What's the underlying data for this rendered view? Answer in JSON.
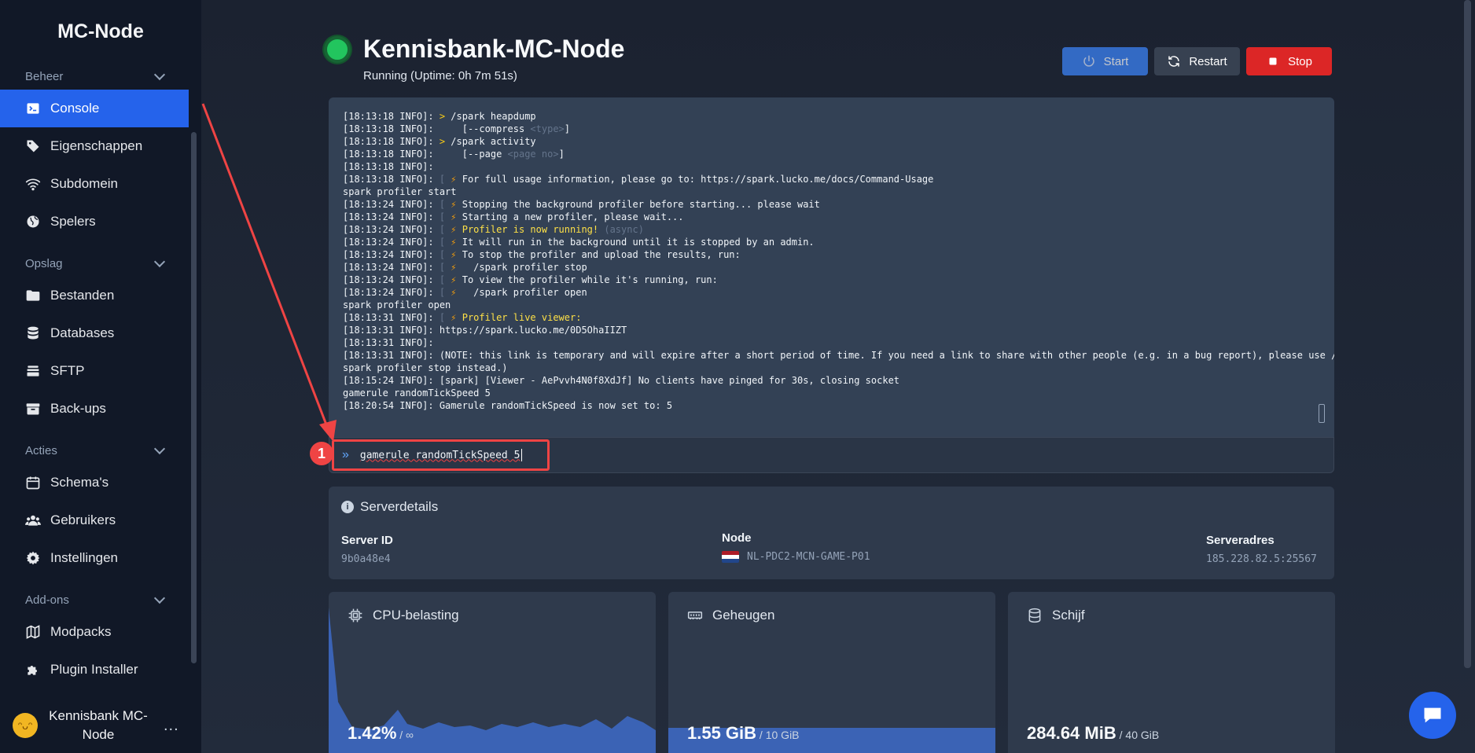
{
  "app": {
    "brand": "MC-Node"
  },
  "sidebar": {
    "sections": [
      {
        "label": "Beheer",
        "items": [
          {
            "label": "Console",
            "icon": "terminal-icon",
            "active": true
          },
          {
            "label": "Eigenschappen",
            "icon": "tag-icon"
          },
          {
            "label": "Subdomein",
            "icon": "wifi-icon"
          },
          {
            "label": "Spelers",
            "icon": "globe-icon"
          }
        ]
      },
      {
        "label": "Opslag",
        "items": [
          {
            "label": "Bestanden",
            "icon": "folder-icon"
          },
          {
            "label": "Databases",
            "icon": "database-icon"
          },
          {
            "label": "SFTP",
            "icon": "layers-icon"
          },
          {
            "label": "Back-ups",
            "icon": "archive-icon"
          }
        ]
      },
      {
        "label": "Acties",
        "items": [
          {
            "label": "Schema's",
            "icon": "calendar-icon"
          },
          {
            "label": "Gebruikers",
            "icon": "users-icon"
          },
          {
            "label": "Instellingen",
            "icon": "gear-icon"
          }
        ]
      },
      {
        "label": "Add-ons",
        "items": [
          {
            "label": "Modpacks",
            "icon": "map-icon"
          },
          {
            "label": "Plugin Installer",
            "icon": "puzzle-icon"
          }
        ]
      }
    ],
    "user": {
      "name": "Kennisbank MC-Node",
      "more": "..."
    }
  },
  "header": {
    "title": "Kennisbank-MC-Node",
    "status": "Running (Uptime: 0h 7m 51s)",
    "status_color": "#22c55e",
    "buttons": {
      "start": "Start",
      "restart": "Restart",
      "stop": "Stop"
    }
  },
  "console": {
    "lines": [
      {
        "p": "[18:13:18 INFO]: ",
        "c": "> ",
        "t": "/spark heapdump"
      },
      {
        "p": "[18:13:18 INFO]: ",
        "t": "    [--compress ",
        "d": "<type>",
        "e": "]"
      },
      {
        "p": "[18:13:18 INFO]: ",
        "c": "> ",
        "t": "/spark activity"
      },
      {
        "p": "[18:13:18 INFO]: ",
        "t": "    [--page ",
        "d": "<page no>",
        "e": "]"
      },
      {
        "p": "[18:13:18 INFO]: "
      },
      {
        "p": "[18:13:18 INFO]: ",
        "b": true,
        "t": "For full usage information, please go to: https://spark.lucko.me/docs/Command-Usage"
      },
      {
        "t": "spark profiler start"
      },
      {
        "p": "[18:13:24 INFO]: ",
        "b": true,
        "t": "Stopping the background profiler before starting... please wait"
      },
      {
        "p": "[18:13:24 INFO]: ",
        "b": true,
        "t": "Starting a new profiler, please wait..."
      },
      {
        "p": "[18:13:24 INFO]: ",
        "b": true,
        "y": "Profiler is now running!",
        "d": " (async)"
      },
      {
        "p": "[18:13:24 INFO]: ",
        "b": true,
        "t": "It will run in the background until it is stopped by an admin."
      },
      {
        "p": "[18:13:24 INFO]: ",
        "b": true,
        "t": "To stop the profiler and upload the results, run:"
      },
      {
        "p": "[18:13:24 INFO]: ",
        "b": true,
        "t": "  /spark profiler stop"
      },
      {
        "p": "[18:13:24 INFO]: ",
        "b": true,
        "t": "To view the profiler while it's running, run:"
      },
      {
        "p": "[18:13:24 INFO]: ",
        "b": true,
        "t": "  /spark profiler open"
      },
      {
        "t": "spark profiler open"
      },
      {
        "p": "[18:13:31 INFO]: ",
        "b": true,
        "y": "Profiler live viewer:"
      },
      {
        "p": "[18:13:31 INFO]: ",
        "t": "https://spark.lucko.me/0D5OhaIIZT"
      },
      {
        "p": "[18:13:31 INFO]: "
      },
      {
        "p": "[18:13:31 INFO]: ",
        "t": "(NOTE: this link is temporary and will expire after a short period of time. If you need a link to share with other people (e.g. in a bug report), please use /"
      },
      {
        "t": "spark profiler stop instead.)"
      },
      {
        "p": "[18:15:24 INFO]: ",
        "t": "[spark] [Viewer - AePvvh4N0f8XdJf] No clients have pinged for 30s, closing socket"
      },
      {
        "t": "gamerule randomTickSpeed 5"
      },
      {
        "p": "[18:20:54 INFO]: ",
        "t": "Gamerule randomTickSpeed is now set to: 5"
      }
    ],
    "bolt": "⚡",
    "input_prefix": "»",
    "input_value": "gamerule randomTickSpeed 5",
    "annotation_number": "1"
  },
  "details": {
    "title": "Serverdetails",
    "server_id_label": "Server ID",
    "server_id": "9b0a48e4",
    "node_label": "Node",
    "node": "NL-PDC2-MCN-GAME-P01",
    "address_label": "Serveradres",
    "address": "185.228.82.5:25567"
  },
  "stats": {
    "cpu": {
      "title": "CPU-belasting",
      "value": "1.42%",
      "max": " / ∞"
    },
    "memory": {
      "title": "Geheugen",
      "value": "1.55 GiB",
      "max": " / 10 GiB",
      "fill_fraction": 0.155
    },
    "disk": {
      "title": "Schijf",
      "value": "284.64 MiB",
      "max": " / 40 GiB"
    }
  },
  "colors": {
    "accent": "#2563eb",
    "stop": "#dc2626",
    "annotation": "#ef4444"
  }
}
